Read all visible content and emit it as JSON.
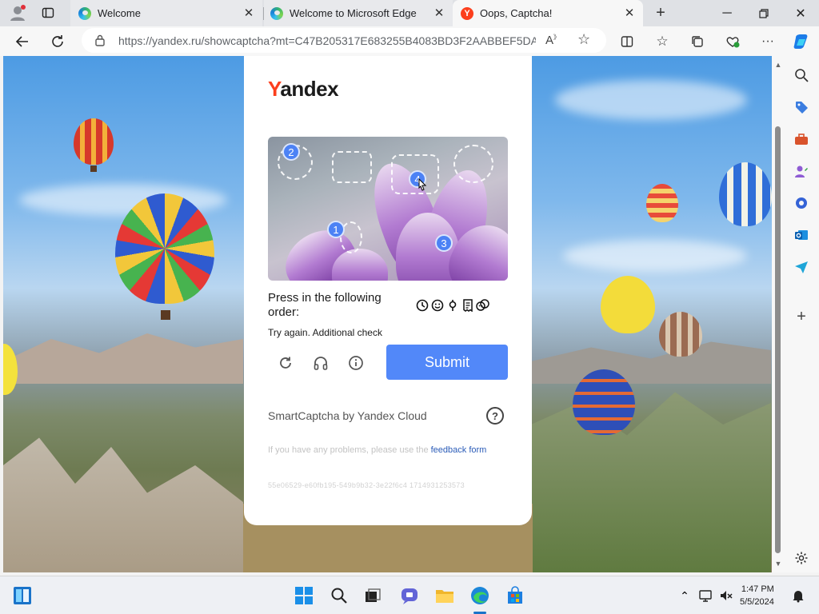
{
  "browser": {
    "tabs": [
      {
        "title": "Welcome",
        "active": false
      },
      {
        "title": "Welcome to Microsoft Edge",
        "active": false
      },
      {
        "title": "Oops, Captcha!",
        "active": true
      }
    ],
    "address_url": "https://yandex.ru/showcaptcha?mt=C47B205317E683255B4083BD3F2AABBEF5DA..."
  },
  "captcha": {
    "brand": {
      "first_letter": "Y",
      "rest": "andex"
    },
    "markers": [
      "1",
      "2",
      "3",
      "4"
    ],
    "instruction": "Press in the following order:",
    "order_icons": [
      "clock-icon",
      "smiley-icon",
      "pin-icon",
      "receipt-icon",
      "theater-icon"
    ],
    "retry_message": "Try again. Additional check",
    "submit_label": "Submit",
    "powered_by": "SmartCaptcha by Yandex Cloud",
    "problems_prefix": "If you have any problems, please use the ",
    "feedback_link": "feedback form",
    "request_id": "55e06529-e60fb195-549b9b32-3e22f6c4 1714931253573"
  },
  "taskbar": {
    "time": "1:47 PM",
    "date": "5/5/2024"
  },
  "colors": {
    "accent": "#5288f9",
    "yandex_red": "#fc3f1d",
    "marker_blue": "#4c82f5"
  }
}
